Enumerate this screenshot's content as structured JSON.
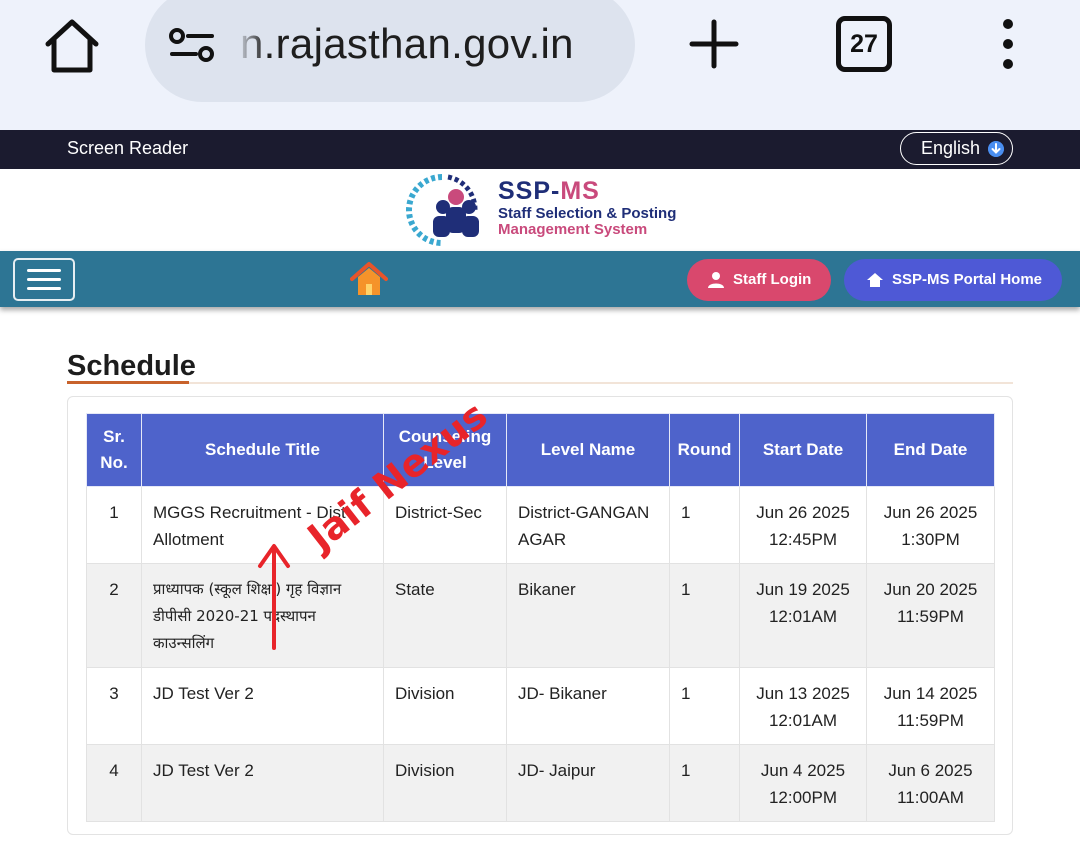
{
  "browser": {
    "url_display": "n.rajasthan.gov.in",
    "tab_count": "27"
  },
  "topbar": {
    "screen_reader": "Screen Reader",
    "language": "English"
  },
  "brand": {
    "title_a": "SSP-",
    "title_b": "MS",
    "line1": "Staff Selection & Posting",
    "line2": "Management System"
  },
  "nav": {
    "staff_login": "Staff Login",
    "portal_home": "SSP-MS Portal Home"
  },
  "schedule": {
    "heading": "Schedule",
    "columns": {
      "sr": "Sr.\nNo.",
      "title": "Schedule Title",
      "counseling_level": "Counseling Level",
      "level_name": "Level Name",
      "round": "Round",
      "start_date": "Start Date",
      "end_date": "End Date"
    },
    "rows": [
      {
        "sr": "1",
        "title": "MGGS Recruitment - Dist Allotment",
        "counseling_level": "District-Sec",
        "level_name": "District-GANGANAGAR",
        "round": "1",
        "start_date": "Jun 26 2025 12:45PM",
        "end_date": "Jun 26 2025 1:30PM"
      },
      {
        "sr": "2",
        "title": "प्राध्यापक (स्कूल शिक्षा) गृह विज्ञान डीपीसी 2020-21 पदस्थापन काउन्सलिंग",
        "counseling_level": "State",
        "level_name": "Bikaner",
        "round": "1",
        "start_date": "Jun 19 2025 12:01AM",
        "end_date": "Jun 20 2025 11:59PM"
      },
      {
        "sr": "3",
        "title": "JD Test Ver 2",
        "counseling_level": "Division",
        "level_name": "JD- Bikaner",
        "round": "1",
        "start_date": "Jun 13 2025 12:01AM",
        "end_date": "Jun 14 2025 11:59PM"
      },
      {
        "sr": "4",
        "title": "JD Test Ver 2",
        "counseling_level": "Division",
        "level_name": "JD- Jaipur",
        "round": "1",
        "start_date": "Jun 4 2025 12:00PM",
        "end_date": "Jun 6 2025 11:00AM"
      }
    ]
  },
  "watermark": {
    "text": "Jaif Nexus"
  },
  "colors": {
    "nav_bar": "#2d7594",
    "table_header": "#4e63cb",
    "staff_login": "#d9486d",
    "portal_home": "#4e59d6",
    "heading_accent": "#c8622b",
    "watermark": "#e8242a"
  },
  "icons": [
    "home-icon",
    "site-settings-icon",
    "plus-icon",
    "tabs-icon",
    "more-vert-icon",
    "download-icon",
    "hamburger-icon",
    "house-icon",
    "user-icon"
  ]
}
